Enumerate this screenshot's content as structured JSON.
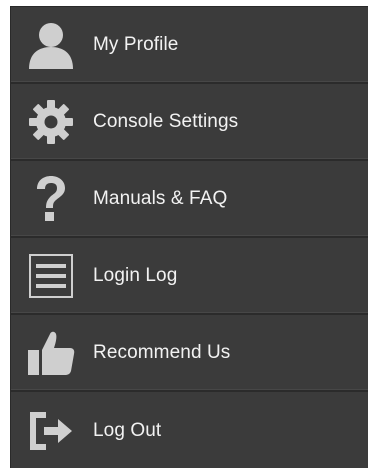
{
  "menu": {
    "items": [
      {
        "label": "My Profile",
        "icon": "user-icon"
      },
      {
        "label": "Console Settings",
        "icon": "gear-icon"
      },
      {
        "label": "Manuals & FAQ",
        "icon": "question-mark-icon"
      },
      {
        "label": "Login Log",
        "icon": "list-icon"
      },
      {
        "label": "Recommend Us",
        "icon": "thumbs-up-icon"
      },
      {
        "label": "Log Out",
        "icon": "logout-icon"
      }
    ]
  },
  "colors": {
    "background": "#3b3b3b",
    "text": "#f2f2f2",
    "icon": "#cfcfcf"
  }
}
